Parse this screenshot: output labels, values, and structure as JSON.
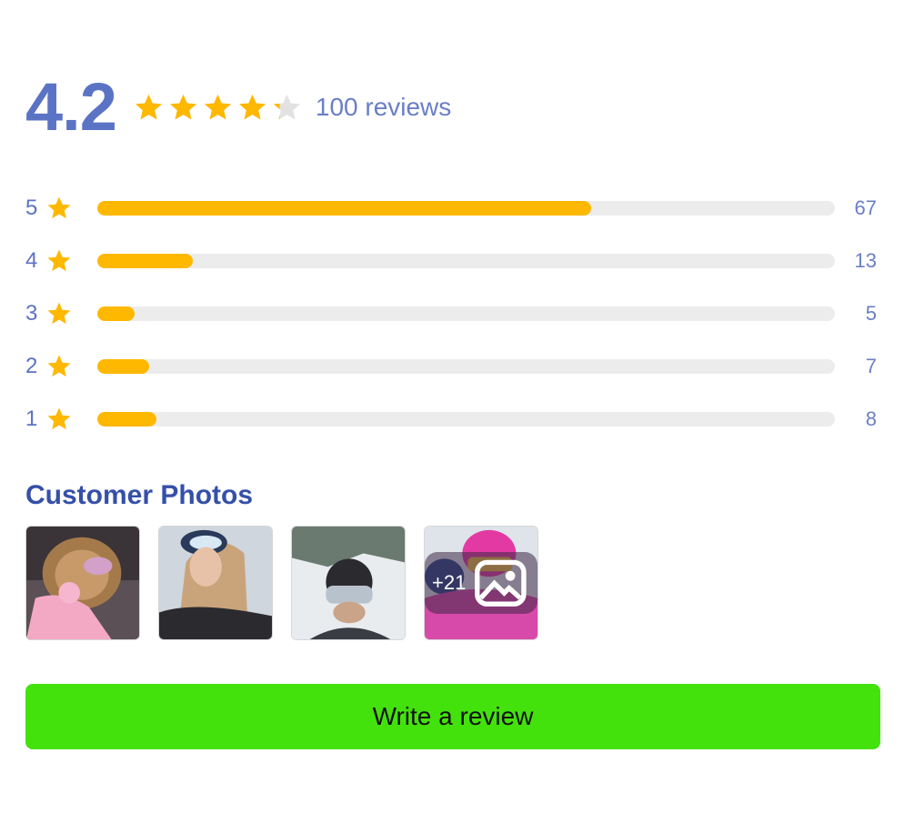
{
  "summary": {
    "average": "4.2",
    "rating_value": 4.2,
    "review_count_text": "100 reviews"
  },
  "distribution": [
    {
      "stars": "5",
      "count": "67",
      "value": 67
    },
    {
      "stars": "4",
      "count": "13",
      "value": 13
    },
    {
      "stars": "3",
      "count": "5",
      "value": 5
    },
    {
      "stars": "2",
      "count": "7",
      "value": 7
    },
    {
      "stars": "1",
      "count": "8",
      "value": 8
    }
  ],
  "distribution_max": 100,
  "photos": {
    "title": "Customer Photos",
    "more_label": "+21"
  },
  "actions": {
    "write_review": "Write a review"
  },
  "colors": {
    "star": "#ffb800",
    "star_empty": "#e2e2e2",
    "button": "#44e20c",
    "heading": "#3550a8"
  }
}
